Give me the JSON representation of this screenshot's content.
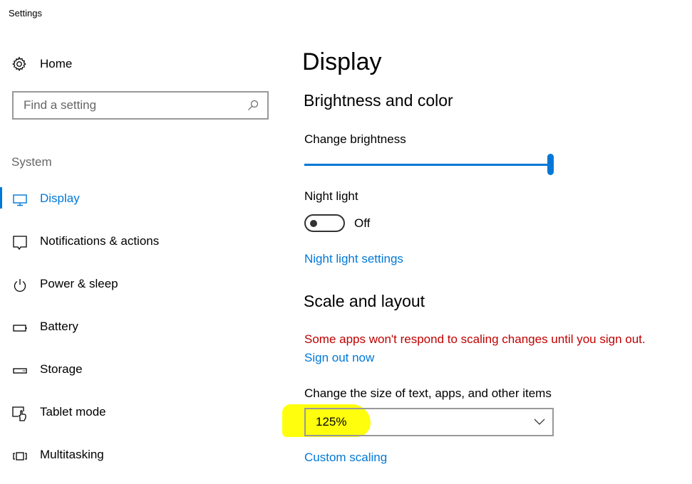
{
  "window": {
    "title": "Settings"
  },
  "sidebar": {
    "home_label": "Home",
    "search": {
      "placeholder": "Find a setting"
    },
    "section": "System",
    "items": [
      {
        "label": "Display",
        "icon": "monitor-icon",
        "active": true
      },
      {
        "label": "Notifications & actions",
        "icon": "notification-icon"
      },
      {
        "label": "Power & sleep",
        "icon": "power-icon"
      },
      {
        "label": "Battery",
        "icon": "battery-icon"
      },
      {
        "label": "Storage",
        "icon": "storage-icon"
      },
      {
        "label": "Tablet mode",
        "icon": "tablet-mode-icon"
      },
      {
        "label": "Multitasking",
        "icon": "multitasking-icon"
      }
    ]
  },
  "main": {
    "title": "Display",
    "brightness": {
      "heading": "Brightness and color",
      "label": "Change brightness",
      "value_percent": 100
    },
    "night_light": {
      "label": "Night light",
      "state": "Off",
      "settings_link": "Night light settings"
    },
    "scale": {
      "heading": "Scale and layout",
      "warning": "Some apps won't respond to scaling changes until you sign out.",
      "sign_out_link": "Sign out now",
      "size_label": "Change the size of text, apps, and other items",
      "size_value": "125%",
      "custom_link": "Custom scaling"
    }
  },
  "colors": {
    "accent": "#0078d7",
    "warning": "#c00000",
    "highlight": "#ffff00"
  }
}
